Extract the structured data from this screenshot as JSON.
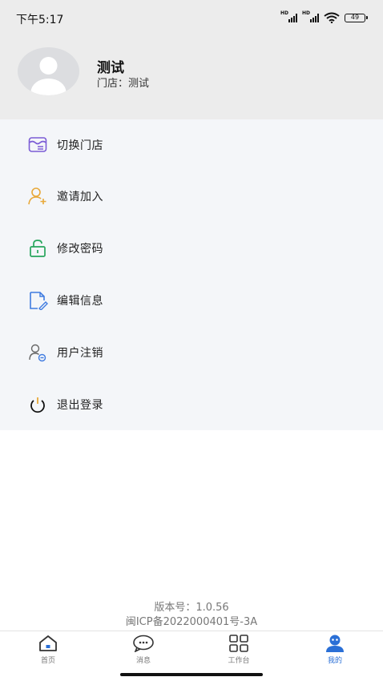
{
  "status_bar": {
    "time": "下午5:17",
    "network_1": "HD",
    "network_2": "HD",
    "battery": "49"
  },
  "profile": {
    "name": "测试",
    "store_label": "门店：",
    "store_value": "测试"
  },
  "menu": {
    "items": [
      {
        "label": "切换门店",
        "icon": "switch-store-icon",
        "color": "#7b5cd6"
      },
      {
        "label": "邀请加入",
        "icon": "add-user-icon",
        "color": "#e8a93a"
      },
      {
        "label": "修改密码",
        "icon": "unlock-icon",
        "color": "#27a55c"
      },
      {
        "label": "编辑信息",
        "icon": "edit-document-icon",
        "color": "#3f7be0"
      },
      {
        "label": "用户注销",
        "icon": "user-cancel-icon",
        "color": "#666666"
      },
      {
        "label": "退出登录",
        "icon": "power-icon",
        "color": "#111111"
      }
    ]
  },
  "footer": {
    "version": "版本号：1.0.56",
    "icp": "闽ICP备2022000401号-3A"
  },
  "tab_bar": {
    "tabs": [
      {
        "label": "首页",
        "icon": "home-icon"
      },
      {
        "label": "消息",
        "icon": "message-icon"
      },
      {
        "label": "工作台",
        "icon": "grid-icon"
      },
      {
        "label": "我的",
        "icon": "mine-icon",
        "active": true
      }
    ],
    "accent": "#2a6fd6"
  }
}
